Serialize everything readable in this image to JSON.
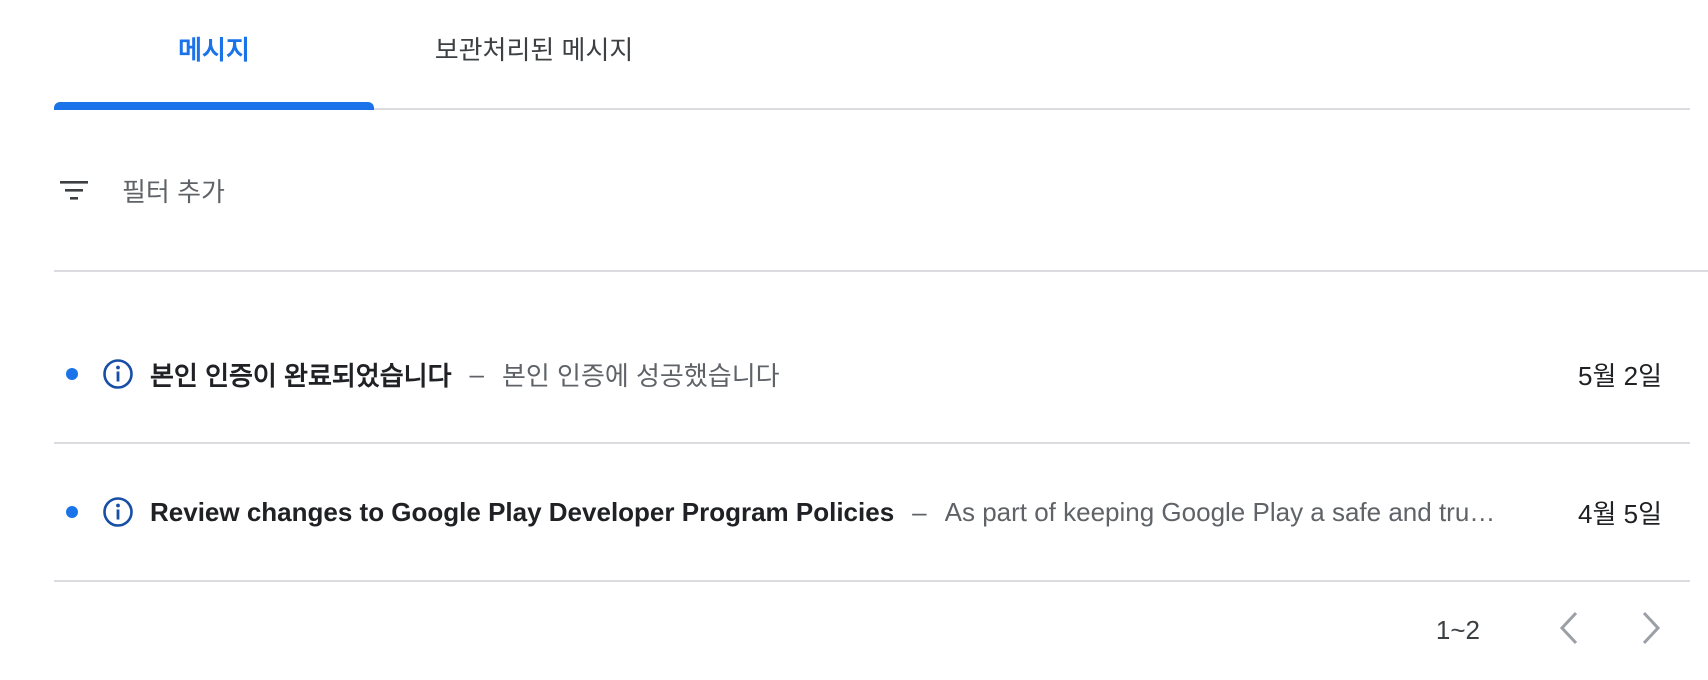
{
  "tabs": {
    "messages_label": "메시지",
    "archived_label": "보관처리된 메시지",
    "active": "messages"
  },
  "filter": {
    "label": "필터 추가",
    "icon": "filter-list-icon"
  },
  "messages": [
    {
      "title": "본인 인증이 완료되었습니다",
      "separator": "–",
      "snippet": "본인 인증에 성공했습니다",
      "date": "5월 2일",
      "unread": true,
      "icon": "info-icon"
    },
    {
      "title": "Review changes to Google Play Developer Program Policies",
      "separator": "–",
      "snippet": "As part of keeping Google Play a safe and trusted experience for users and developers",
      "date": "4월 5일",
      "unread": true,
      "icon": "info-icon"
    }
  ],
  "pagination": {
    "range": "1~2",
    "prev_icon": "chevron-left-icon",
    "next_icon": "chevron-right-icon"
  },
  "colors": {
    "accent": "#1a73e8",
    "divider": "#dadce0",
    "info_icon": "#174ea6",
    "secondary_text": "#5f6368",
    "disabled_icon": "#9aa0a6"
  }
}
